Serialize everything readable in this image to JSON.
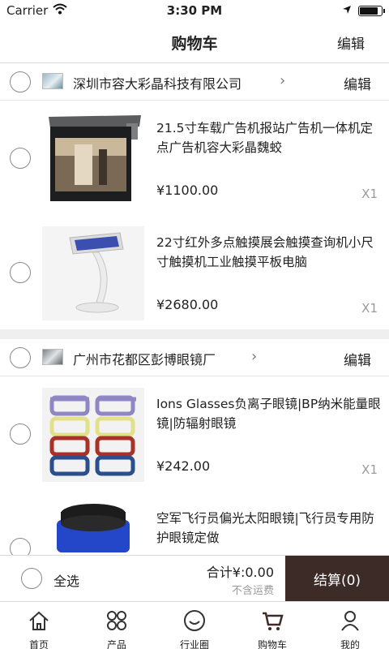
{
  "status_bar": {
    "carrier": "Carrier",
    "time": "3:30 PM"
  },
  "nav": {
    "title": "购物车",
    "edit_label": "编辑"
  },
  "shops": [
    {
      "name": "深圳市容大彩晶科技有限公司",
      "chevron": "›",
      "edit_label": "编辑",
      "items": [
        {
          "title": "21.5寸车载广告机报站广告机一体机定点广告机容大彩晶魏蛟",
          "price": "¥1100.00",
          "qty": "X1"
        },
        {
          "title": "22寸红外多点触摸展会触摸查询机小尺寸触摸机工业触摸平板电脑",
          "price": "¥2680.00",
          "qty": "X1"
        }
      ]
    },
    {
      "name": "广州市花都区彭博眼镜厂",
      "chevron": "›",
      "edit_label": "编辑",
      "items": [
        {
          "title": "Ions Glasses负离子眼镜|BP纳米能量眼镜|防辐射眼镜",
          "price": "¥242.00",
          "qty": "X1"
        },
        {
          "title": "空军飞行员偏光太阳眼镜|飞行员专用防护眼镜定做",
          "price": "",
          "qty": ""
        }
      ]
    }
  ],
  "footer": {
    "select_all": "全选",
    "total": "合计¥:0.00",
    "shipping_note": "不含运费",
    "checkout_label": "结算(0)"
  },
  "tabs": [
    {
      "label": "首页",
      "icon": "home-icon"
    },
    {
      "label": "产品",
      "icon": "grid-icon"
    },
    {
      "label": "行业圈",
      "icon": "smile-icon"
    },
    {
      "label": "购物车",
      "icon": "cart-icon"
    },
    {
      "label": "我的",
      "icon": "user-icon"
    }
  ],
  "colors": {
    "checkout_bg": "#3d2b28",
    "divider": "#efefef"
  }
}
